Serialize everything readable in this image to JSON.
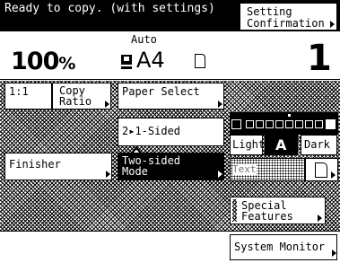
{
  "status": {
    "text": "Ready to copy. (with settings)"
  },
  "setting_confirmation": {
    "line1": "Setting",
    "line2": "Confirmation"
  },
  "info": {
    "ratio": "100",
    "ratio_unit": "%",
    "paper_mode": "Auto",
    "paper_size": "A4",
    "copies": "1"
  },
  "buttons": {
    "one_to_one": "1:1",
    "copy_ratio_line1": "Copy",
    "copy_ratio_line2": "Ratio",
    "paper_select": "Paper Select",
    "two_one_sided": "2▸1-Sided",
    "finisher": "Finisher",
    "two_sided_line1": "Two-sided",
    "two_sided_line2": "Mode",
    "special_line1": "Special",
    "special_line2": "Features",
    "system_monitor": "System Monitor"
  },
  "density": {
    "light": "Light",
    "auto": "A",
    "dark": "Dark",
    "text_mode": "Text",
    "level_boxes": 9
  },
  "colors": {
    "background": "#ffffff",
    "foreground": "#000000"
  },
  "icons": [
    "paper-tray-icon",
    "orientation-icon",
    "arrow-right-icon",
    "original-type-icon",
    "density-light-icon",
    "density-dark-icon"
  ]
}
